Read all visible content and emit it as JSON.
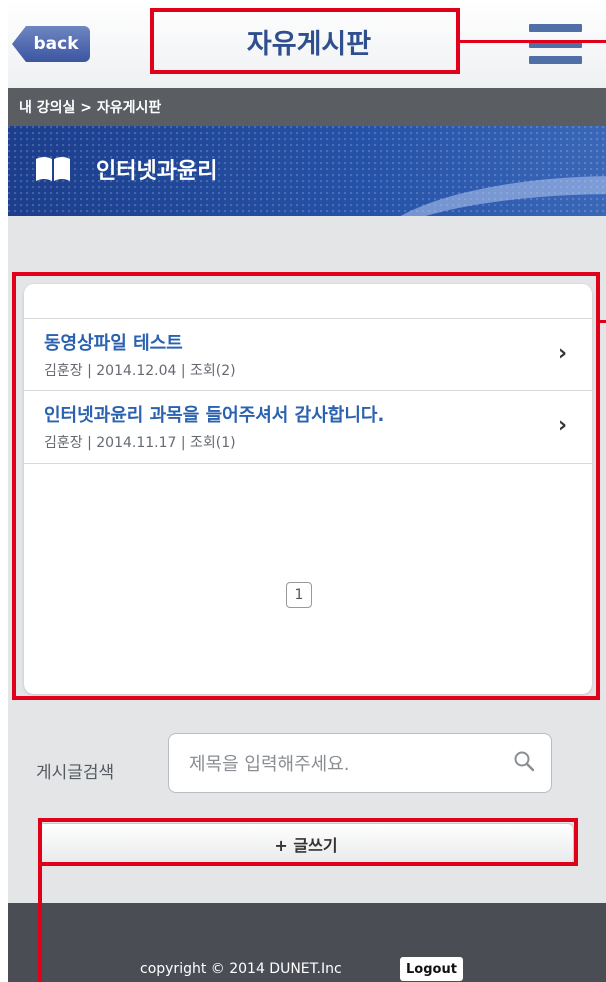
{
  "header": {
    "back_label": "back",
    "title": "자유게시판"
  },
  "breadcrumb": {
    "text": "내 강의실 > 자유게시판"
  },
  "course": {
    "name": "인터넷과윤리"
  },
  "posts": [
    {
      "title": "동영상파일 테스트",
      "meta": "김훈장  |  2014.12.04  | 조회(2)"
    },
    {
      "title": "인터넷과윤리 과목을 들어주셔서 감사합니다.",
      "meta": "김훈장  |  2014.11.17  | 조회(1)"
    }
  ],
  "pagination": {
    "current_page": "1"
  },
  "search": {
    "label": "게시글검색",
    "placeholder": "제목을 입력해주세요."
  },
  "write_button": {
    "label": "+ 글쓰기"
  },
  "footer": {
    "copyright": "copyright © 2014 DUNET.Inc",
    "logout_label": "Logout"
  },
  "colors": {
    "accent_blue": "#2f4f8f",
    "link_blue": "#2a62b0",
    "annotation_red": "#e0001a",
    "footer_gray": "#4a4e54"
  }
}
